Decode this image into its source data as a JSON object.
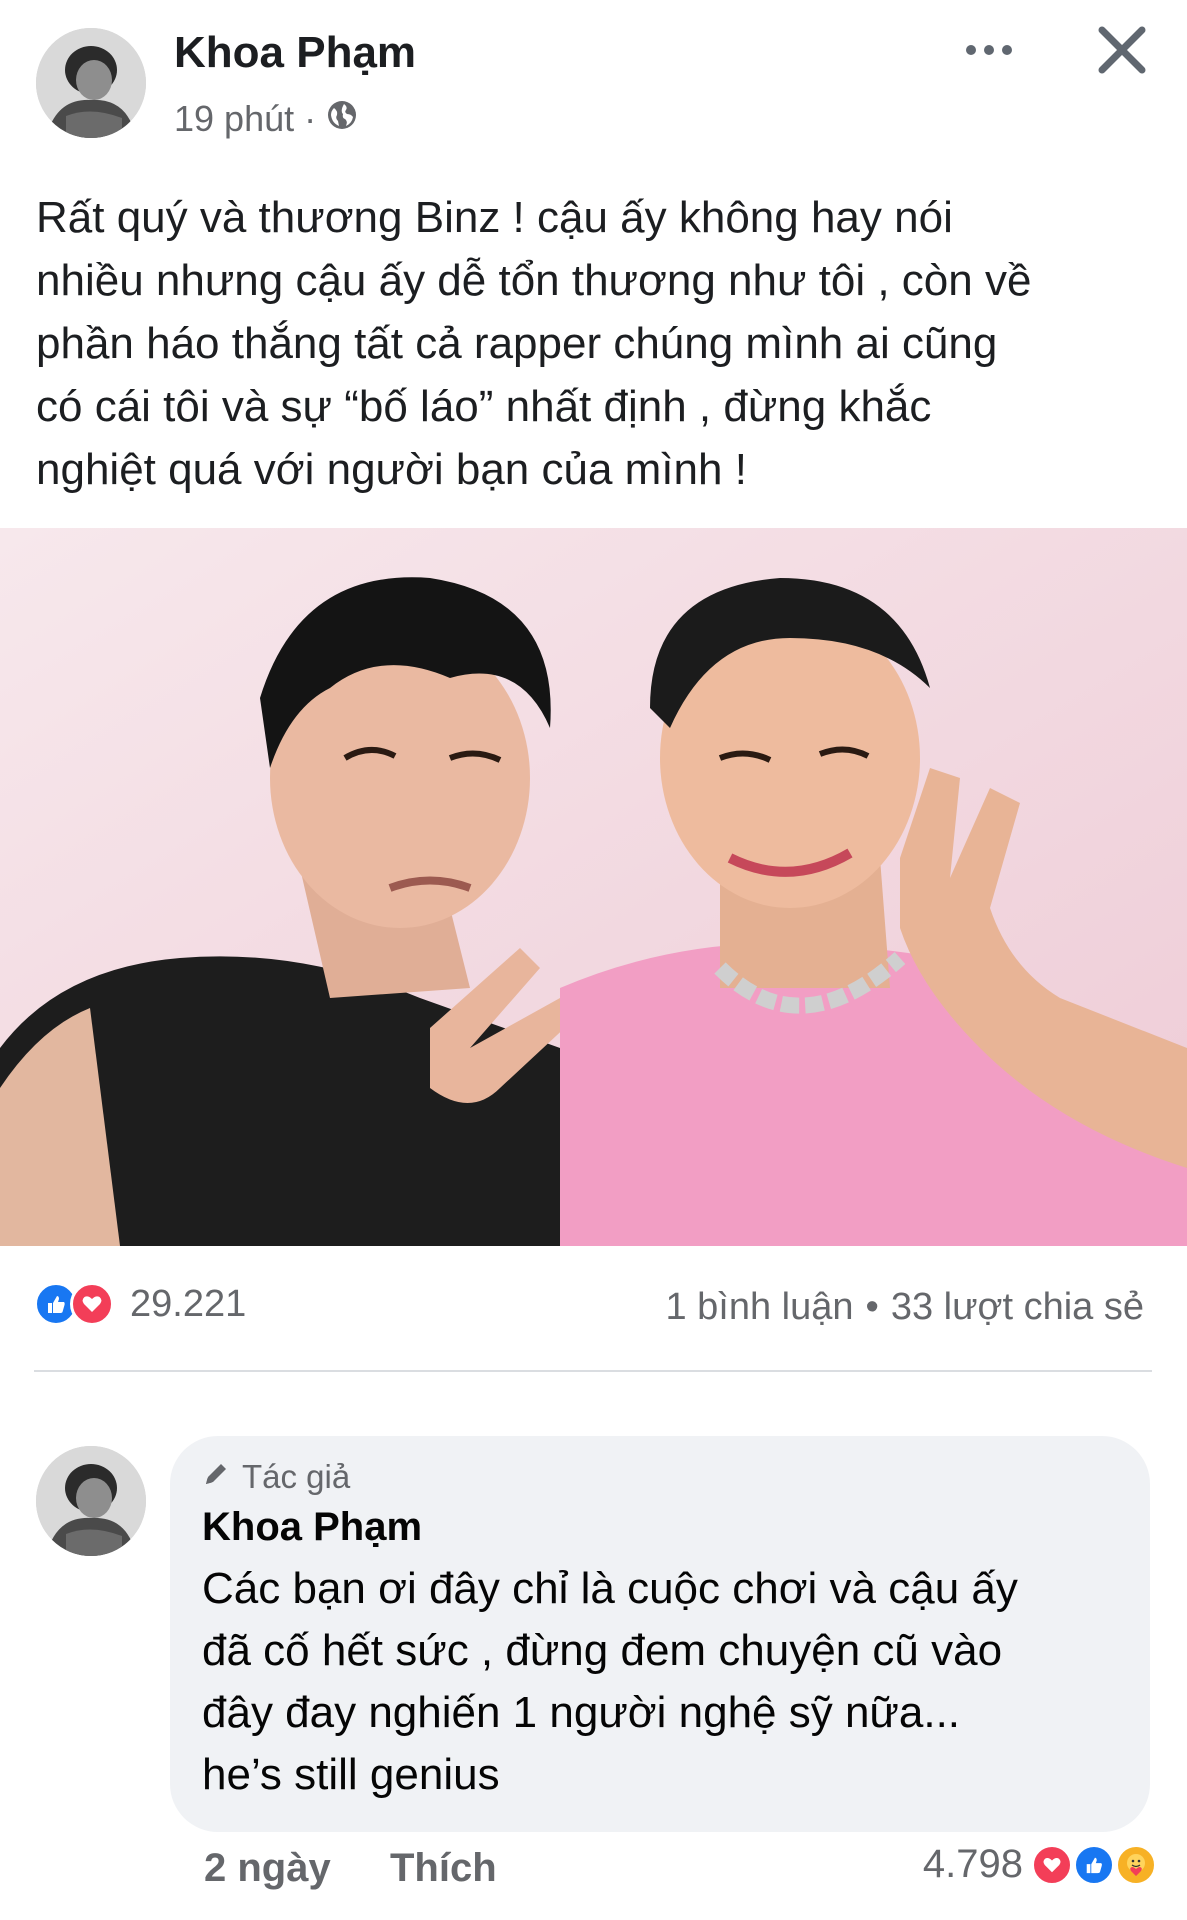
{
  "post": {
    "author": "Khoa Phạm",
    "time": "19 phút",
    "separator": "·",
    "privacy_icon": "globe-icon",
    "text_lines": [
      "Rất quý và thương Binz ! cậu ấy không hay nói",
      "nhiều nhưng cậu ấy dễ tổn thương như tôi , còn về",
      "phần háo thắng tất cả rapper chúng mình ai cũng",
      "có cái tôi và sự “bố láo” nhất định , đừng khắc",
      "nghiệt quá với người bạn của mình !"
    ],
    "photo": "selfie of two men, one winking in a black leather vest, one smiling in a pink t-shirt with a chain necklace, making V-sign gestures"
  },
  "reactions": {
    "icons": [
      "like-icon",
      "love-icon"
    ],
    "count": "29.221",
    "comments": "1 bình luận",
    "bullet": "•",
    "shares": "33 lượt chia sẻ"
  },
  "comment": {
    "badge": "Tác giả",
    "author": "Khoa Phạm",
    "text_lines": [
      "Các bạn ơi đây chỉ là cuộc chơi và cậu ấy",
      "đã cố hết sức , đừng đem chuyện cũ vào",
      "đây đay nghiến 1 người nghệ sỹ nữa...",
      "he’s still genius"
    ],
    "time": "2 ngày",
    "like_label": "Thích",
    "reaction_count": "4.798",
    "reaction_icons": [
      "love-icon",
      "like-icon",
      "care-icon"
    ]
  },
  "colors": {
    "like": "#1877f2",
    "love": "#f33e58",
    "care": "#f7b125",
    "secondary_text": "#65676b",
    "bubble": "#f0f2f5"
  }
}
